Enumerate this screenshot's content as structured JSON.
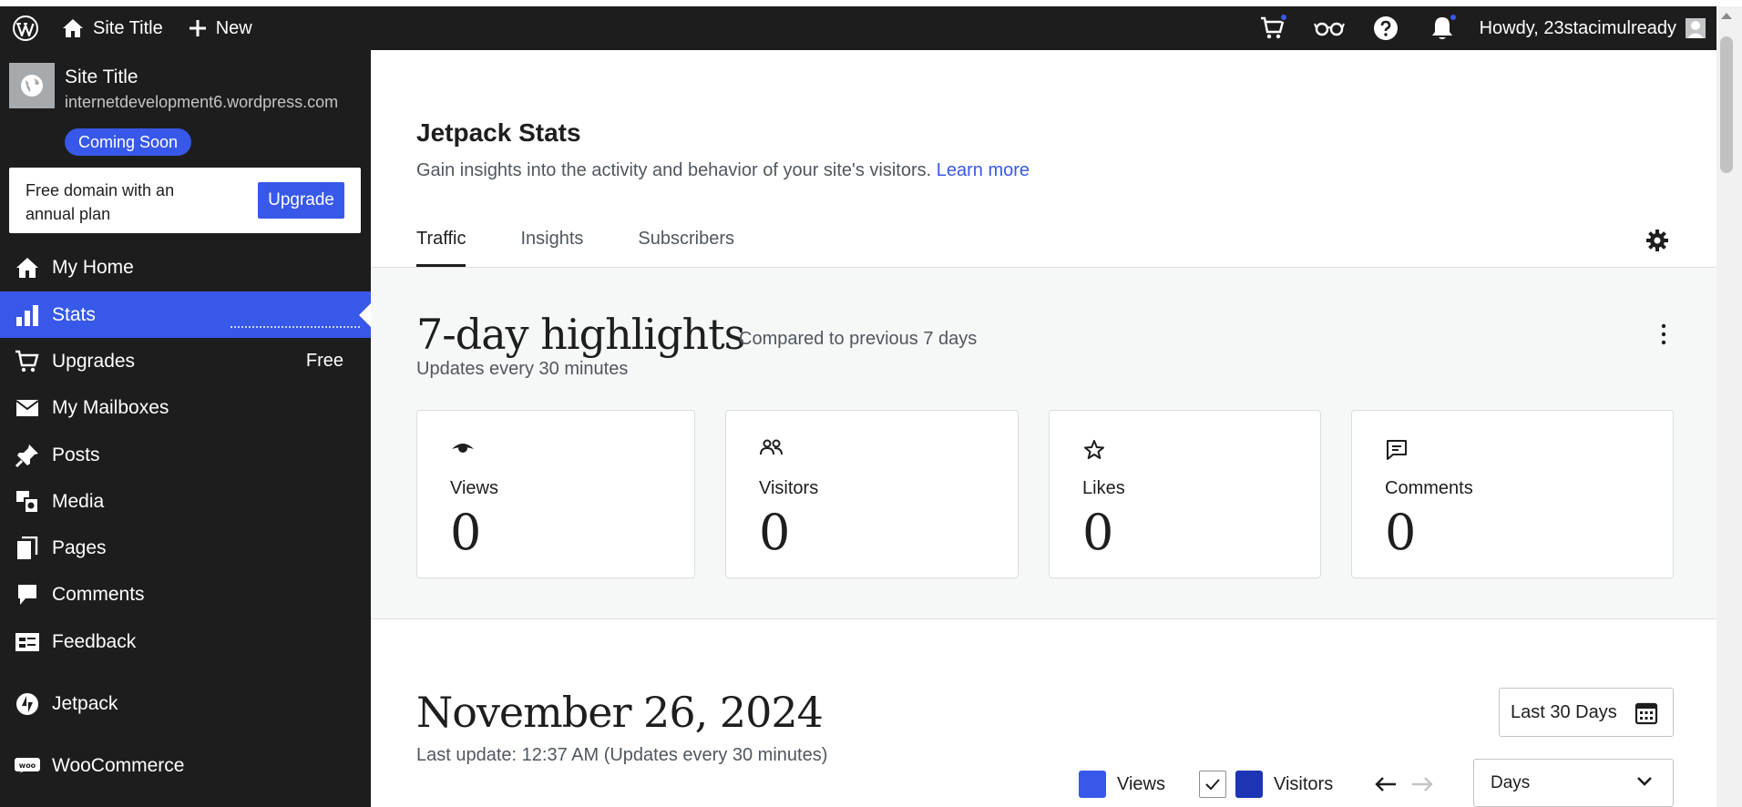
{
  "admin_bar": {
    "site_title": "Site Title",
    "new_label": "New",
    "howdy": "Howdy, 23stacimulready",
    "icons": [
      "wordpress-logo-icon",
      "home-icon",
      "plus-icon",
      "cart-icon",
      "reader-icon",
      "help-icon",
      "notifications-icon"
    ]
  },
  "sidebar": {
    "site_name": "Site Title",
    "site_url": "internetdevelopment6.wordpress.com",
    "coming_soon": "Coming Soon",
    "promo_text": "Free domain with an annual plan",
    "promo_button": "Upgrade",
    "items": [
      {
        "label": "My Home",
        "icon": "home-icon"
      },
      {
        "label": "Stats",
        "icon": "stats-icon",
        "active": true
      },
      {
        "label": "Upgrades",
        "icon": "cart-icon",
        "badge": "Free"
      },
      {
        "label": "My Mailboxes",
        "icon": "mail-icon"
      },
      {
        "label": "Posts",
        "icon": "pin-icon"
      },
      {
        "label": "Media",
        "icon": "media-icon"
      },
      {
        "label": "Pages",
        "icon": "pages-icon"
      },
      {
        "label": "Comments",
        "icon": "comment-icon"
      },
      {
        "label": "Feedback",
        "icon": "feedback-icon"
      },
      {
        "label": "Jetpack",
        "icon": "jetpack-icon"
      },
      {
        "label": "WooCommerce",
        "icon": "woo-icon"
      }
    ]
  },
  "main": {
    "title": "Jetpack Stats",
    "subtitle": "Gain insights into the activity and behavior of your site's visitors.",
    "learn_more": "Learn more",
    "tabs": [
      {
        "label": "Traffic",
        "active": true
      },
      {
        "label": "Insights"
      },
      {
        "label": "Subscribers"
      }
    ]
  },
  "highlights": {
    "title": "7-day highlights",
    "compare": "Compared to previous 7 days",
    "updates": "Updates every 30 minutes",
    "cards": [
      {
        "label": "Views",
        "value": "0",
        "icon": "eye-icon"
      },
      {
        "label": "Visitors",
        "value": "0",
        "icon": "people-icon"
      },
      {
        "label": "Likes",
        "value": "0",
        "icon": "star-icon"
      },
      {
        "label": "Comments",
        "value": "0",
        "icon": "comment-icon"
      }
    ]
  },
  "traffic": {
    "date_title": "November 26, 2024",
    "last_update": "Last update: 12:37 AM (Updates every 30 minutes)",
    "range_button": "Last 30 Days",
    "legend": [
      {
        "label": "Views",
        "color": "#3858e9"
      },
      {
        "label": "Visitors",
        "color": "#1d35b4",
        "checked": true
      }
    ],
    "period_select": "Days"
  },
  "colors": {
    "accent": "#3858e9",
    "admin_bg": "#1d1d1d",
    "muted_text": "#50575e"
  }
}
